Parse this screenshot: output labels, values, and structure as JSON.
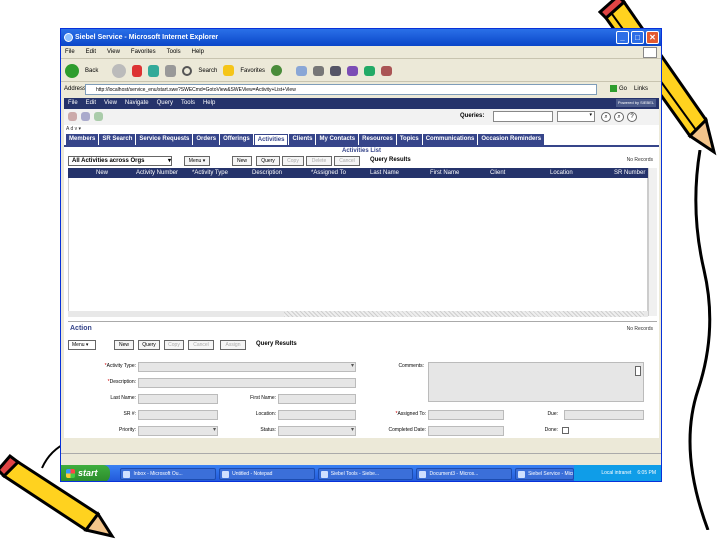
{
  "window": {
    "title": "Siebel Service - Microsoft Internet Explorer",
    "controls": [
      "_",
      "□",
      "✕"
    ]
  },
  "ie_menu": [
    "File",
    "Edit",
    "View",
    "Favorites",
    "Tools",
    "Help"
  ],
  "ie_toolbar": {
    "back": "Back",
    "search": "Search",
    "favorites": "Favorites"
  },
  "address": {
    "label": "Address",
    "url": "http://localhost/service_enu/start.swe?SWECmd=GotoView&SWEView=Activity+List+View",
    "go": "Go",
    "links": "Links"
  },
  "app": {
    "menu": [
      "File",
      "Edit",
      "View",
      "Navigate",
      "Query",
      "Tools",
      "Help"
    ],
    "logo": "Powered by SIEBEL",
    "queries_label": "Queries:",
    "help_text": "A d v ▾",
    "tabs": [
      {
        "label": "Members",
        "active": false
      },
      {
        "label": "SR Search",
        "active": false
      },
      {
        "label": "Service Requests",
        "active": false
      },
      {
        "label": "Orders",
        "active": false
      },
      {
        "label": "Offerings",
        "active": false
      },
      {
        "label": "Activities",
        "active": true
      },
      {
        "label": "Clients",
        "active": false
      },
      {
        "label": "My Contacts",
        "active": false
      },
      {
        "label": "Resources",
        "active": false
      },
      {
        "label": "Topics",
        "active": false
      },
      {
        "label": "Communications",
        "active": false
      },
      {
        "label": "Occasion Reminders",
        "active": false
      }
    ],
    "subtab": "Activities List",
    "list_controls": {
      "select_value": "All Activities across Orgs",
      "menu": "Menu ▾",
      "buttons": [
        {
          "label": "New",
          "enabled": true
        },
        {
          "label": "Query",
          "enabled": true
        },
        {
          "label": "Copy",
          "enabled": false
        },
        {
          "label": "Delete",
          "enabled": false
        },
        {
          "label": "Cancel",
          "enabled": false
        }
      ],
      "query_results": "Query Results",
      "no_records": "No Records"
    },
    "columns": [
      "New",
      "Activity Number",
      "*Activity Type",
      "Description",
      "*Assigned To",
      "Last Name",
      "First Name",
      "Client",
      "Location",
      "SR Number"
    ],
    "form": {
      "title": "Action",
      "right_text": "No Records",
      "menu": "Menu ▾",
      "buttons": [
        {
          "label": "New",
          "enabled": true
        },
        {
          "label": "Query",
          "enabled": true
        },
        {
          "label": "Copy",
          "enabled": false
        },
        {
          "label": "Cancel",
          "enabled": false
        },
        {
          "label": "Assign",
          "enabled": false
        }
      ],
      "query_results": "Query Results",
      "fields": {
        "activity_type": "Activity Type:",
        "description": "Description:",
        "comments": "Comments:",
        "last_name": "Last Name:",
        "first_name": "First Name:",
        "sr_num": "SR #:",
        "location": "Location:",
        "assigned_to": "Assigned To:",
        "due": "Due:",
        "priority": "Priority:",
        "status": "Status:",
        "completed_date": "Completed Date:",
        "done": "Done:"
      }
    }
  },
  "taskbar": {
    "start": "start",
    "items": [
      "Inbox - Microsoft Ou...",
      "Untitled - Notepad",
      "Siebel Tools - Siebe...",
      "Document3 - Micros...",
      "Siebel Service - Micr..."
    ],
    "status": "Local intranet",
    "clock": "6:05 PM"
  },
  "colors": {
    "siebel_nav": "#25336b",
    "xp_blue": "#2157d9",
    "start_green": "#2b8b2b"
  }
}
